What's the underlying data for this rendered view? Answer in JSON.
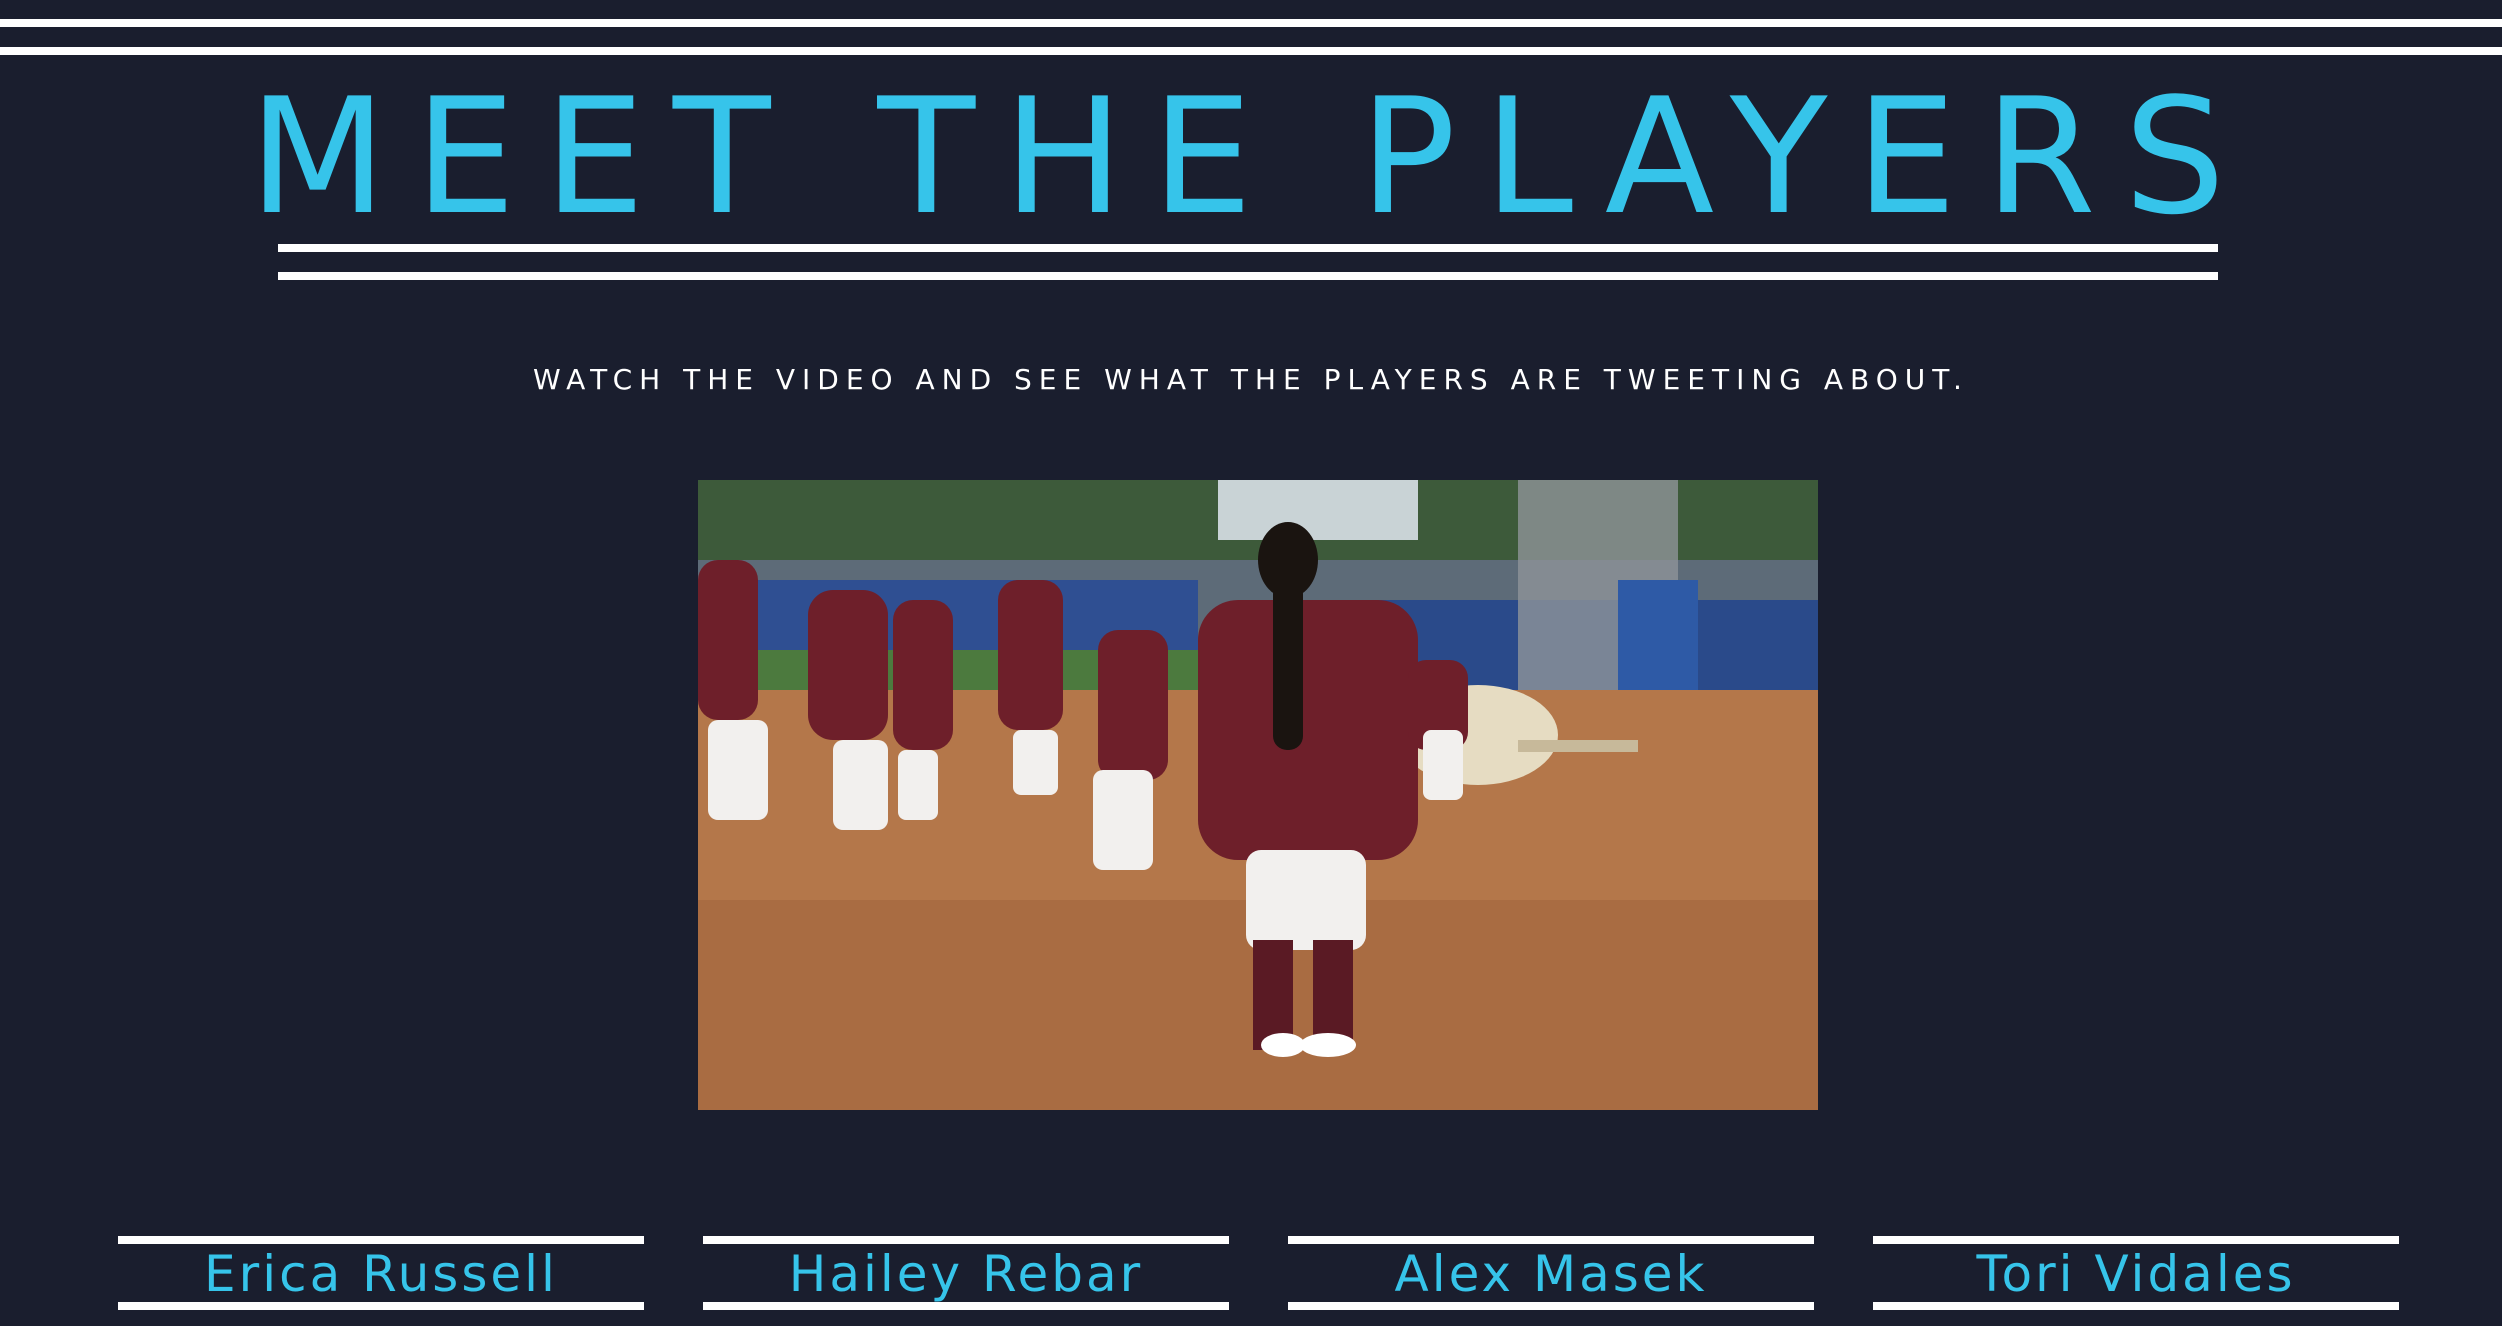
{
  "header": {
    "title": "MEET THE PLAYERS",
    "subtitle": "WATCH THE VIDEO AND SEE WHAT THE PLAYERS ARE TWEETING ABOUT."
  },
  "video": {
    "content": "softball-team-video-still"
  },
  "players": [
    {
      "name": "Erica Russell"
    },
    {
      "name": "Hailey Rebar"
    },
    {
      "name": "Alex Masek"
    },
    {
      "name": "Tori Vidales"
    }
  ],
  "colors": {
    "background": "#1a1e2e",
    "accent": "#36c4ea",
    "rule": "#ffffff"
  }
}
